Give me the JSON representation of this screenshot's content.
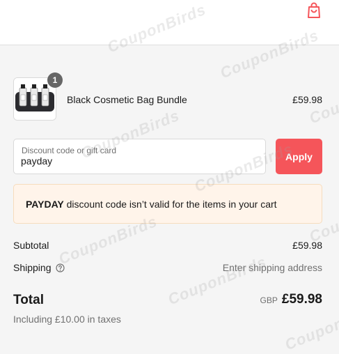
{
  "header": {
    "cart_icon": "shopping-bag-icon",
    "accent_color": "#f5555a"
  },
  "watermark": {
    "text": "CouponBirds"
  },
  "product": {
    "quantity": "1",
    "name": "Black Cosmetic Bag Bundle",
    "price": "£59.98",
    "image": "cosmetic-bag-bundle-thumbnail"
  },
  "discount": {
    "label": "Discount code or gift card",
    "value": "payday",
    "apply_label": "Apply"
  },
  "error": {
    "code": "PAYDAY",
    "message": " discount code isn’t valid for the items in your cart"
  },
  "summary": {
    "subtotal_label": "Subtotal",
    "subtotal_value": "£59.98",
    "shipping_label": "Shipping",
    "shipping_icon": "help-circle-icon",
    "shipping_value": "Enter shipping address",
    "total_label": "Total",
    "currency": "GBP",
    "total_value": "£59.98",
    "taxes_note": "Including £10.00 in taxes"
  }
}
